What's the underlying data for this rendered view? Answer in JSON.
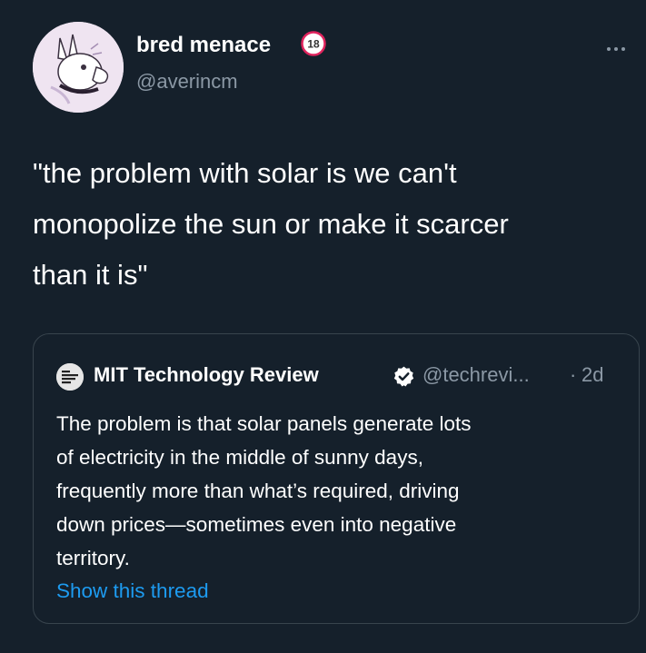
{
  "author": {
    "display_name": "bred menace",
    "handle": "@averincm",
    "age_badge": "18",
    "avatar_icon": "cartoon-animal-avatar",
    "more_icon": "more-options-icon"
  },
  "tweet": {
    "text": "\"the problem with solar is we can't\nmonopolize the sun or make it scarcer\nthan it is\""
  },
  "quote": {
    "logo_icon": "mit-technology-review-logo",
    "display_name": "MIT Technology Review",
    "verified": true,
    "handle": "@techrevi...",
    "separator": "·",
    "time": "2d",
    "text": "The problem is that solar panels generate lots\nof electricity in the middle of sunny days,\nfrequently more than what’s required, driving\ndown prices—sometimes even into negative\nterritory.",
    "show_thread_label": "Show this thread"
  },
  "colors": {
    "background": "#15202b",
    "secondary_text": "#8b98a5",
    "link": "#1d9bf0",
    "border": "#38444d",
    "badge_red": "#e0245e"
  }
}
